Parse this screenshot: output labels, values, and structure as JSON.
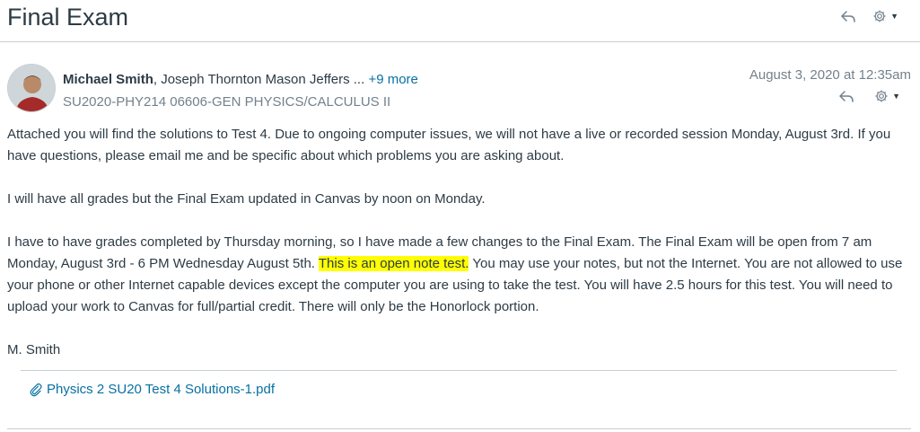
{
  "page": {
    "title": "Final Exam"
  },
  "message": {
    "author": "Michael Smith",
    "recipients": ", Joseph Thornton Mason Jeffers ...",
    "more_link": "+9 more",
    "course": "SU2020-PHY214 06606-GEN PHYSICS/CALCULUS II",
    "date": "August 3, 2020 at 12:35am",
    "body": {
      "p1": "Attached you will find the solutions to Test 4. Due to ongoing computer issues, we will not have a live or recorded session Monday, August 3rd. If you have questions, please email me and be specific about which problems you are asking about.",
      "p2": "I will have all grades but the Final Exam updated in Canvas by noon on Monday.",
      "p3_before": "I have to have grades completed by Thursday morning, so I have made a few changes to the Final Exam. The Final Exam will be open from 7 am Monday, August 3rd - 6 PM Wednesday August 5th. ",
      "p3_highlight": "This is an open note test.",
      "p3_after": " You may use your notes, but not the Internet. You are not allowed to use your phone or other Internet capable devices except the computer you are using to take the test. You will have 2.5 hours for this test. You will need to upload your work to Canvas for full/partial credit. There will only be the Honorlock portion.",
      "signature": "M. Smith"
    },
    "attachment": {
      "name": "Physics 2 SU20 Test 4 Solutions-1.pdf",
      "icon": "paperclip-icon"
    },
    "highlight_color": "#ffff00",
    "link_color": "#0770a3"
  }
}
